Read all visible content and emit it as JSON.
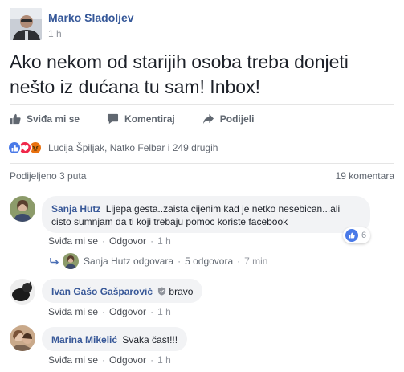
{
  "post": {
    "author": "Marko Sladoljev",
    "time": "1 h",
    "text": "Ako nekom od starijih osoba treba donjeti nešto iz dućana tu sam! Inbox!"
  },
  "actions": {
    "like": "Sviđa mi se",
    "comment": "Komentiraj",
    "share": "Podijeli"
  },
  "reactions": {
    "summary": "Lucija Špiljak, Natko Felbar i 249 drugih",
    "types": [
      "like-icon",
      "love-icon",
      "angry-icon"
    ]
  },
  "stats": {
    "shares": "Podijeljeno 3 puta",
    "comments": "19 komentara"
  },
  "comments": [
    {
      "name": "Sanja Hutz",
      "text": "Lijepa gesta..zaista cijenim kad je netko nesebican...ali cisto sumnjam da ti koji trebaju pomoc koriste facebook",
      "like": "Sviđa mi se",
      "reply": "Odgovor",
      "time": "1 h",
      "reactions": "6"
    },
    {
      "name": "Ivan Gašo Gašparović",
      "text": "bravo",
      "like": "Sviđa mi se",
      "reply": "Odgovor",
      "time": "1 h"
    },
    {
      "name": "Marina Mikelić",
      "text": "Svaka čast!!!",
      "like": "Sviđa mi se",
      "reply": "Odgovor",
      "time": "1 h"
    }
  ],
  "reply_summary": {
    "name": "Sanja Hutz",
    "verb": "odgovara",
    "count": "5 odgovora",
    "time": "7 min"
  },
  "colors": {
    "link": "#365899",
    "like_blue": "#4a7ae8",
    "love_red": "#f0284a",
    "angry_orange": "#e9710f",
    "bubble": "#f2f3f5"
  }
}
